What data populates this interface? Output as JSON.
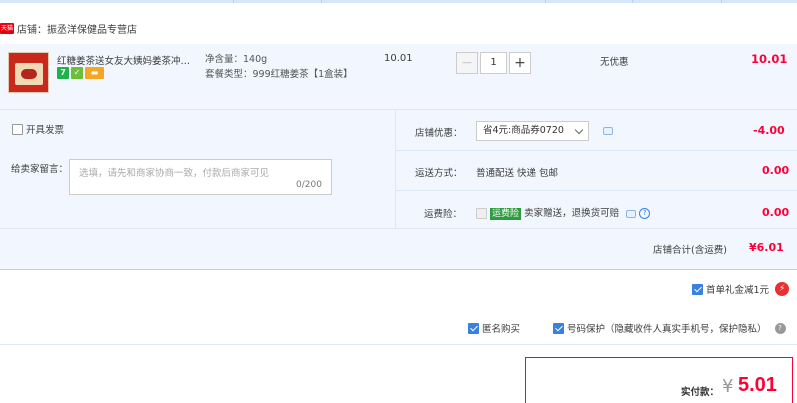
{
  "shop": {
    "badge": "天猫",
    "label": "店铺：振丞洋保健品专营店"
  },
  "product": {
    "title": "红糖姜茶送女友大姨妈姜茶冲泡...",
    "spec_weight": "净含量：140g",
    "spec_package": "套餐类型：999红糖姜茶【1盒装】",
    "unit_price": "10.01",
    "quantity": "1",
    "promo": "无优惠",
    "subtotal": "10.01",
    "icons": [
      "7",
      "✓",
      "▬"
    ]
  },
  "invoice": {
    "label": "开具发票",
    "checked": false
  },
  "message": {
    "label": "给卖家留言：",
    "placeholder": "选填，请先和商家协商一致，付款后商家可见",
    "counter": "0/200"
  },
  "shop_discount": {
    "label": "店铺优惠：",
    "selected": "省4元:商品券0720",
    "amount": "-4.00"
  },
  "shipping": {
    "label": "运送方式：",
    "value": "普通配送 快递 包邮",
    "amount": "0.00"
  },
  "insurance": {
    "label": "运费险：",
    "tag": "运费险",
    "text": "卖家赠送，退换货可赔",
    "amount": "0.00",
    "help": "?"
  },
  "shop_total": {
    "label": "店铺合计(含运费)",
    "amount": "¥6.01"
  },
  "first_order": {
    "label": "首单礼金减1元",
    "checked": true,
    "bolt": "⚡"
  },
  "options": {
    "anonymous": {
      "label": "匿名购买",
      "checked": true
    },
    "phone_protect": {
      "label": "号码保护（隐藏收件人真实手机号，保护隐私）",
      "checked": true
    }
  },
  "payment": {
    "label": "实付款：",
    "yen": "¥",
    "amount": "5.01"
  },
  "colors": {
    "accent": "#ff0036",
    "blue": "#3a7fe3",
    "row_bg": "#f2f7ff"
  }
}
